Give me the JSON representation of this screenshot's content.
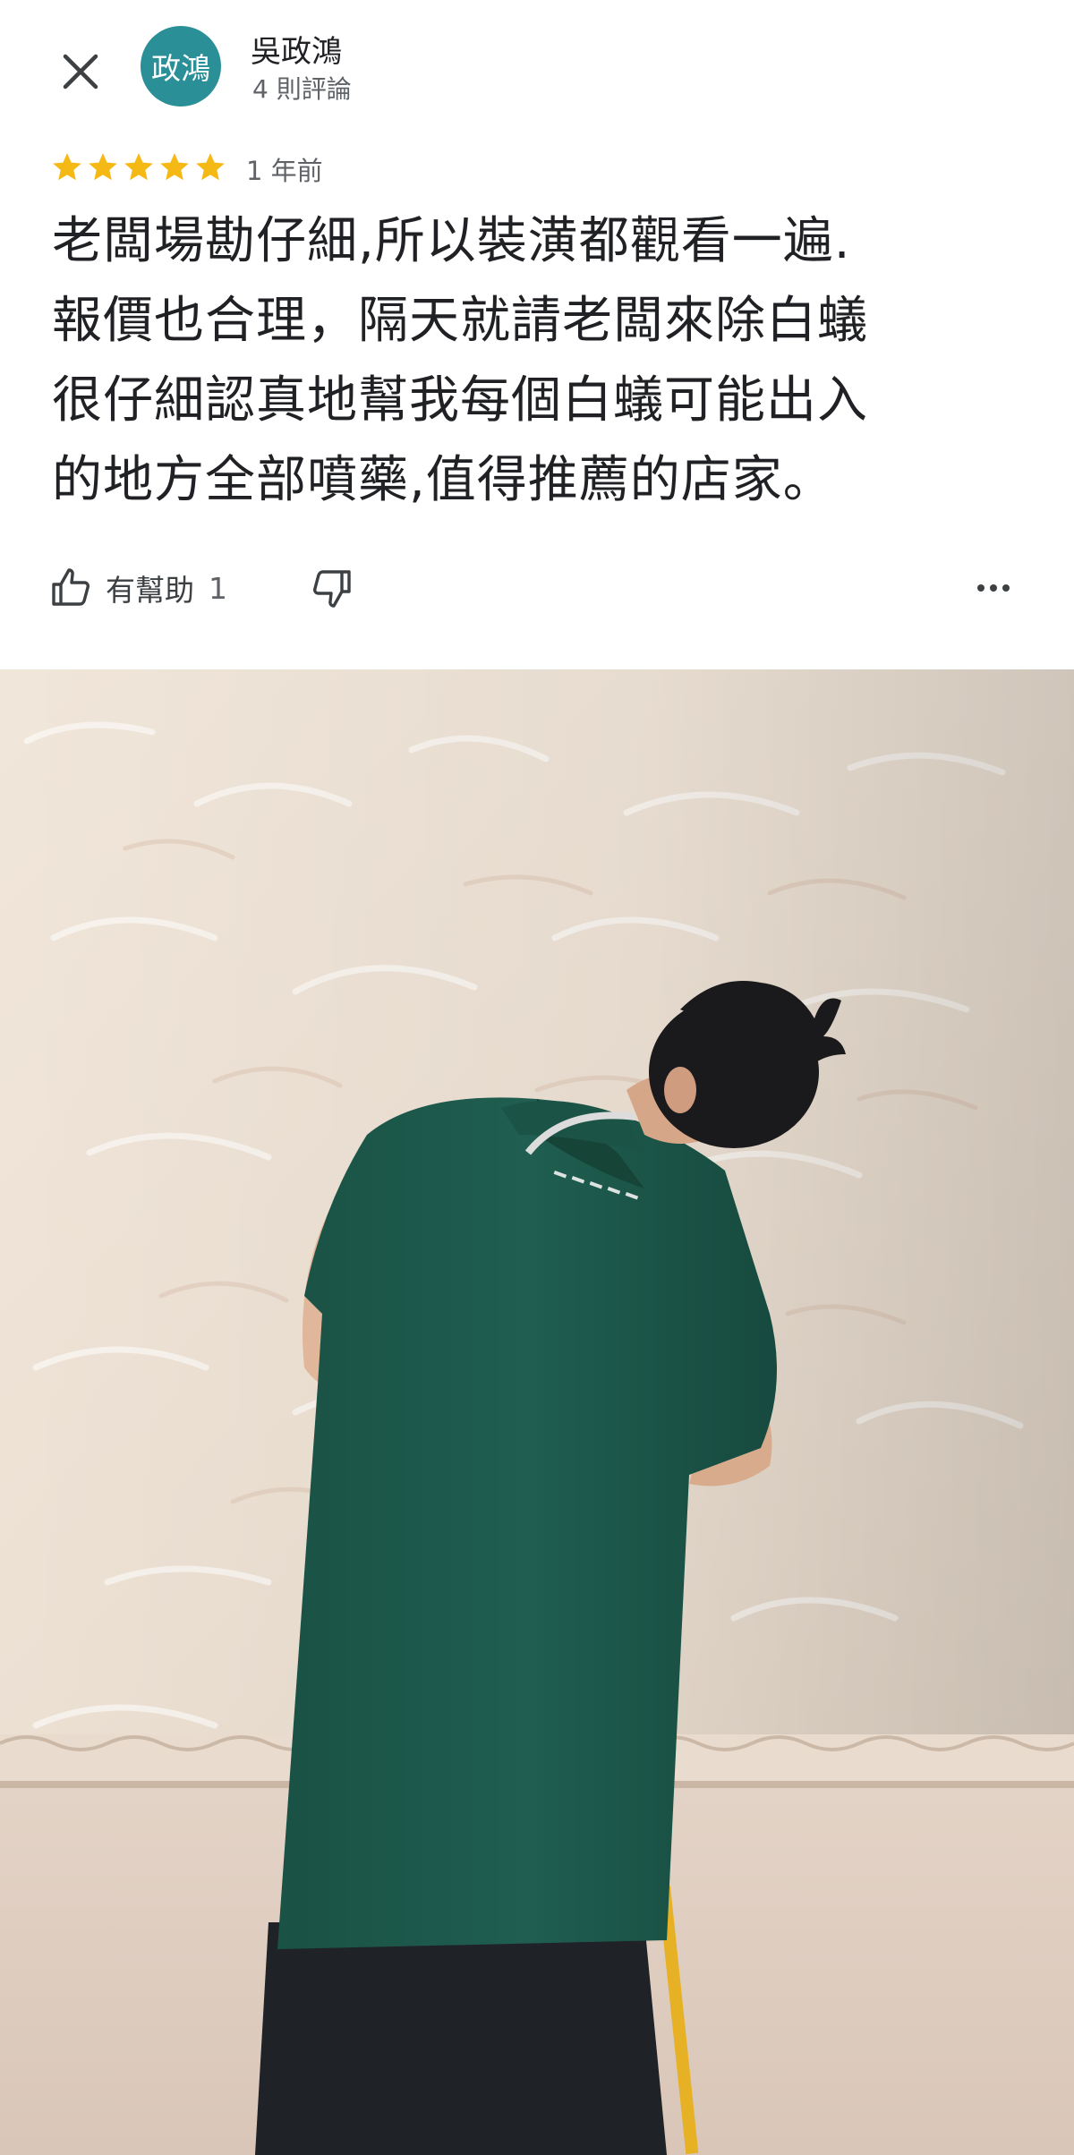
{
  "header": {
    "close_icon": "close-icon",
    "avatar_text": "政鴻",
    "avatar_color": "#2a8f97",
    "user_name": "吳政鴻",
    "review_count": "4 則評論"
  },
  "review": {
    "rating": 5,
    "max_rating": 5,
    "star_color": "#f5b916",
    "time_ago": "1 年前",
    "text": "老闆場勘仔細,所以裝潢都觀看一遍.\n報價也合理，隔天就請老闆來除白蟻\n很仔細認真地幫我每個白蟻可能出入\n的地方全部噴藥,值得推薦的店家。"
  },
  "actions": {
    "helpful_icon": "thumbs-up-icon",
    "helpful_label": "有幫助",
    "helpful_count": "1",
    "dislike_icon": "thumbs-down-icon",
    "more_icon": "more-horizontal-icon"
  },
  "photo": {
    "description_icon": "review-photo",
    "shirt_color": "#1e5a4c",
    "wall_color": "#efe3d6"
  }
}
